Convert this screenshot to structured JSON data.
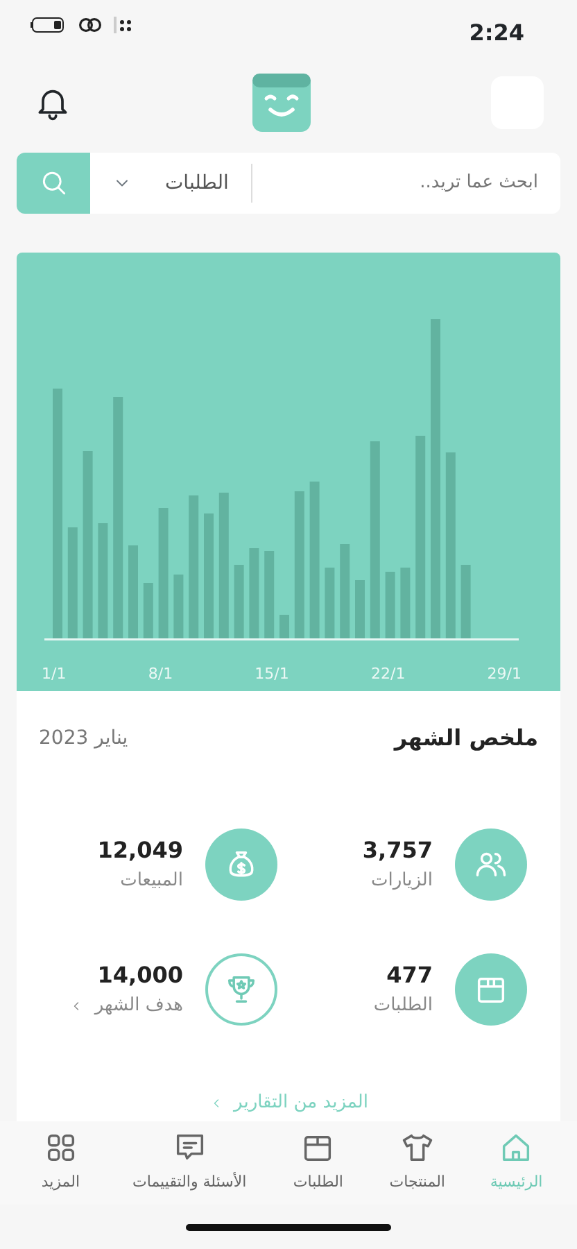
{
  "status_bar": {
    "time": "2:24"
  },
  "search": {
    "placeholder": "ابحث عما تريد..",
    "category": "الطلبات"
  },
  "chart": {
    "x_labels": [
      "29/1",
      "22/1",
      "15/1",
      "8/1",
      "1/1"
    ]
  },
  "summary": {
    "title": "ملخص الشهر",
    "period": "يناير 2023",
    "stats": [
      {
        "kind": "visits",
        "value": "3,757",
        "label": "الزيارات"
      },
      {
        "kind": "sales",
        "value": "12,049",
        "label": "المبيعات"
      },
      {
        "kind": "orders",
        "value": "477",
        "label": "الطلبات"
      },
      {
        "kind": "goal",
        "value": "14,000",
        "label": "هدف الشهر"
      }
    ],
    "more_link": "المزيد من التقارير"
  },
  "bottom_nav": [
    {
      "kind": "home",
      "label": "الرئيسية",
      "selected": true
    },
    {
      "kind": "products",
      "label": "المنتجات",
      "selected": false
    },
    {
      "kind": "orders",
      "label": "الطلبات",
      "selected": false
    },
    {
      "kind": "reviews",
      "label": "الأسئلة والتقييمات",
      "selected": false
    },
    {
      "kind": "more",
      "label": "المزيد",
      "selected": false
    }
  ]
}
